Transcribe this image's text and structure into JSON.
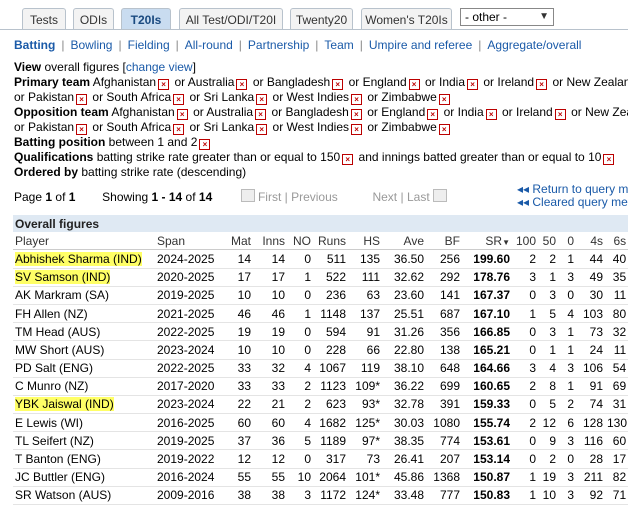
{
  "tabs": [
    "Tests",
    "ODIs",
    "T20Is",
    "All Test/ODI/T20I",
    "Twenty20",
    "Women's T20Is"
  ],
  "active_tab": "T20Is",
  "other_select": "- other -",
  "subnav": [
    "Batting",
    "Bowling",
    "Fielding",
    "All-round",
    "Partnership",
    "Team",
    "Umpire and referee",
    "Aggregate/overall"
  ],
  "active_subnav": "Batting",
  "filters": {
    "view_label": "View",
    "view_value": "overall figures",
    "change_view": "change view",
    "primary_label": "Primary team",
    "opposition_label": "Opposition team",
    "teams_line1": [
      "Afghanistan",
      "Australia",
      "Bangladesh",
      "England",
      "India",
      "Ireland",
      "New Zealand"
    ],
    "teams_line2": [
      "Pakistan",
      "South Africa",
      "Sri Lanka",
      "West Indies",
      "Zimbabwe"
    ],
    "or": "or",
    "batting_position_label": "Batting position",
    "batting_position_value": "between 1 and 2",
    "qualifications_label": "Qualifications",
    "qualification_1": "batting strike rate greater than or equal to 150",
    "qualification_and": "and",
    "qualification_2": "innings batted greater than or equal to 10",
    "ordered_label": "Ordered by",
    "ordered_value": "batting strike rate (descending)"
  },
  "pager": {
    "page": "Page",
    "page_num": "1",
    "of": "of",
    "page_total": "1",
    "showing": "Showing",
    "range": "1 - 14",
    "range_of": "of",
    "range_total": "14",
    "first": "First",
    "previous": "Previous",
    "next": "Next",
    "last": "Last",
    "return_link": "Return to query me",
    "cleared_link": "Cleared query me"
  },
  "table": {
    "caption": "Overall figures",
    "columns": [
      "Player",
      "Span",
      "Mat",
      "Inns",
      "NO",
      "Runs",
      "HS",
      "Ave",
      "BF",
      "SR",
      "100",
      "50",
      "0",
      "4s",
      "6s"
    ],
    "sort_indicator": "▼",
    "rows": [
      [
        "Abhishek Sharma (IND)",
        "2024-2025",
        "14",
        "14",
        "0",
        "511",
        "135",
        "36.50",
        "256",
        "199.60",
        "2",
        "2",
        "1",
        "44",
        "40"
      ],
      [
        "SV Samson (IND)",
        "2020-2025",
        "17",
        "17",
        "1",
        "522",
        "111",
        "32.62",
        "292",
        "178.76",
        "3",
        "1",
        "3",
        "49",
        "35"
      ],
      [
        "AK Markram (SA)",
        "2019-2025",
        "10",
        "10",
        "0",
        "236",
        "63",
        "23.60",
        "141",
        "167.37",
        "0",
        "3",
        "0",
        "30",
        "11"
      ],
      [
        "FH Allen (NZ)",
        "2021-2025",
        "46",
        "46",
        "1",
        "1148",
        "137",
        "25.51",
        "687",
        "167.10",
        "1",
        "5",
        "4",
        "103",
        "80"
      ],
      [
        "TM Head (AUS)",
        "2022-2025",
        "19",
        "19",
        "0",
        "594",
        "91",
        "31.26",
        "356",
        "166.85",
        "0",
        "3",
        "1",
        "73",
        "32"
      ],
      [
        "MW Short (AUS)",
        "2023-2024",
        "10",
        "10",
        "0",
        "228",
        "66",
        "22.80",
        "138",
        "165.21",
        "0",
        "1",
        "1",
        "24",
        "11"
      ],
      [
        "PD Salt (ENG)",
        "2022-2025",
        "33",
        "32",
        "4",
        "1067",
        "119",
        "38.10",
        "648",
        "164.66",
        "3",
        "4",
        "3",
        "106",
        "54"
      ],
      [
        "C Munro (NZ)",
        "2017-2020",
        "33",
        "33",
        "2",
        "1123",
        "109*",
        "36.22",
        "699",
        "160.65",
        "2",
        "8",
        "1",
        "91",
        "69"
      ],
      [
        "YBK Jaiswal (IND)",
        "2023-2024",
        "22",
        "21",
        "2",
        "623",
        "93*",
        "32.78",
        "391",
        "159.33",
        "0",
        "5",
        "2",
        "74",
        "31"
      ],
      [
        "E Lewis (WI)",
        "2016-2025",
        "60",
        "60",
        "4",
        "1682",
        "125*",
        "30.03",
        "1080",
        "155.74",
        "2",
        "12",
        "6",
        "128",
        "130"
      ],
      [
        "TL Seifert (NZ)",
        "2019-2025",
        "37",
        "36",
        "5",
        "1189",
        "97*",
        "38.35",
        "774",
        "153.61",
        "0",
        "9",
        "3",
        "116",
        "60"
      ],
      [
        "T Banton (ENG)",
        "2019-2022",
        "12",
        "12",
        "0",
        "317",
        "73",
        "26.41",
        "207",
        "153.14",
        "0",
        "2",
        "0",
        "28",
        "17"
      ],
      [
        "JC Buttler (ENG)",
        "2016-2024",
        "55",
        "55",
        "10",
        "2064",
        "101*",
        "45.86",
        "1368",
        "150.87",
        "1",
        "19",
        "3",
        "211",
        "82"
      ],
      [
        "SR Watson (AUS)",
        "2009-2016",
        "38",
        "38",
        "3",
        "1172",
        "124*",
        "33.48",
        "777",
        "150.83",
        "1",
        "10",
        "3",
        "92",
        "71"
      ]
    ],
    "highlighted_rows": [
      0,
      1,
      8
    ]
  },
  "colors": {
    "link": "#1a5aa8",
    "highlight": "#ffff66",
    "caption_bg": "#dfe9f3",
    "active_tab_bg": "#c9dcf0"
  }
}
